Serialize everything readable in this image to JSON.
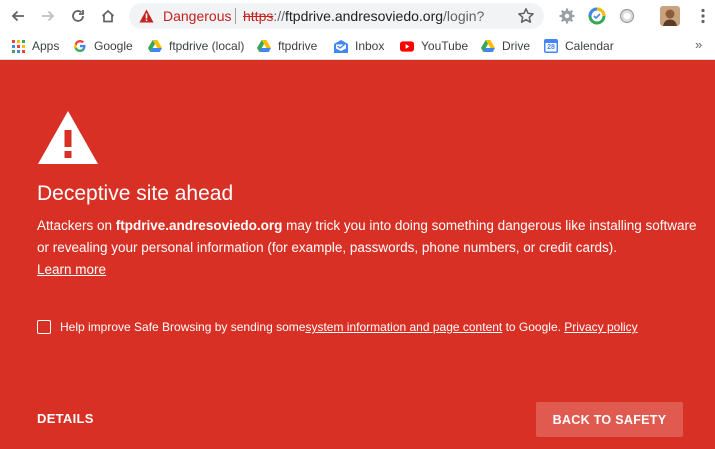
{
  "colors": {
    "danger_background": "#d93025",
    "danger_text": "#c5221f",
    "button_background": "#e05a50"
  },
  "toolbar": {
    "back_icon": "arrow-left-icon",
    "forward_icon": "arrow-right-icon",
    "reload_icon": "reload-icon",
    "home_icon": "home-icon",
    "security_state": "Dangerous",
    "url_scheme": "https",
    "url_separator": "://",
    "url_host": "ftpdrive.andresoviedo.org",
    "url_path": "/login?",
    "bookmark_star_icon": "star-icon",
    "menu_icon": "more-vertical-icon"
  },
  "bookmarks": [
    {
      "label": "Apps",
      "icon": "apps-grid-icon"
    },
    {
      "label": "Google",
      "icon": "google-g-icon"
    },
    {
      "label": "ftpdrive (local)",
      "icon": "drive-icon"
    },
    {
      "label": "ftpdrive",
      "icon": "drive-icon"
    },
    {
      "label": "Inbox",
      "icon": "inbox-icon"
    },
    {
      "label": "YouTube",
      "icon": "youtube-icon"
    },
    {
      "label": "Drive",
      "icon": "drive-icon"
    },
    {
      "label": "Calendar",
      "icon": "calendar-icon",
      "badge": "28"
    }
  ],
  "bookmarks_overflow": "»",
  "interstitial": {
    "title": "Deceptive site ahead",
    "body_prefix": "Attackers on ",
    "body_host": "ftpdrive.andresoviedo.org",
    "body_suffix": " may trick you into doing something dangerous like installing software or revealing your personal information (for example, passwords, phone numbers, or credit cards).",
    "learn_more": "Learn more",
    "optin_prefix": "Help improve Safe Browsing by sending some ",
    "optin_link": "system information and page content",
    "optin_middle": " to Google. ",
    "privacy_link": "Privacy policy",
    "optin_checked": false,
    "details_label": "DETAILS",
    "back_to_safety_label": "BACK TO SAFETY"
  }
}
